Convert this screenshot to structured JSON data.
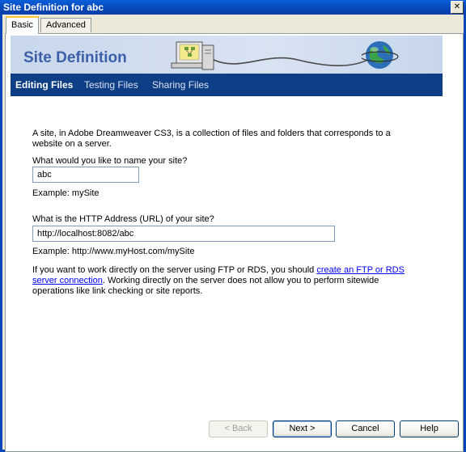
{
  "window": {
    "title": "Site Definition for abc",
    "close_glyph": "✕"
  },
  "tabs": [
    {
      "label": "Basic",
      "active": true
    },
    {
      "label": "Advanced",
      "active": false
    }
  ],
  "banner": {
    "title": "Site Definition"
  },
  "nav": [
    {
      "label": "Editing Files",
      "active": true
    },
    {
      "label": "Testing Files",
      "active": false
    },
    {
      "label": "Sharing Files",
      "active": false
    }
  ],
  "content": {
    "intro": "A site, in Adobe Dreamweaver CS3, is a collection of files and folders that corresponds to a website on a server.",
    "name_question": "What would you like to name your site?",
    "name_value": "abc",
    "name_example": "Example: mySite",
    "url_question": "What is the HTTP Address (URL) of your site?",
    "url_value": "http://localhost:8082/abc",
    "url_example": "Example: http://www.myHost.com/mySite",
    "ftp_text_before": "If you want to work directly on the server using FTP or RDS, you should ",
    "ftp_link": "create an FTP or RDS server connection",
    "ftp_text_after": ".  Working directly on the server does not allow you to perform sitewide operations like link checking or site reports."
  },
  "buttons": {
    "back": "< Back",
    "next": "Next >",
    "cancel": "Cancel",
    "help": "Help"
  }
}
